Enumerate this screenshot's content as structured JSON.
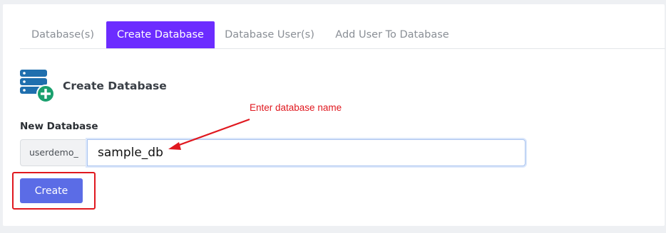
{
  "tabs": [
    {
      "label": "Database(s)",
      "active": false
    },
    {
      "label": "Create Database",
      "active": true
    },
    {
      "label": "Database User(s)",
      "active": false
    },
    {
      "label": "Add User To Database",
      "active": false
    }
  ],
  "section": {
    "title": "Create Database",
    "icon": "database-add-icon"
  },
  "form": {
    "label": "New Database",
    "prefix": "userdemo_",
    "value": "sample_db"
  },
  "button": {
    "label": "Create"
  },
  "annotation": {
    "text": "Enter database name"
  },
  "colors": {
    "accent": "#6c2cff",
    "button": "#5b6ce6",
    "annotation": "#e0181f",
    "icon_blue": "#1f6fae",
    "icon_green": "#1aa06e"
  }
}
